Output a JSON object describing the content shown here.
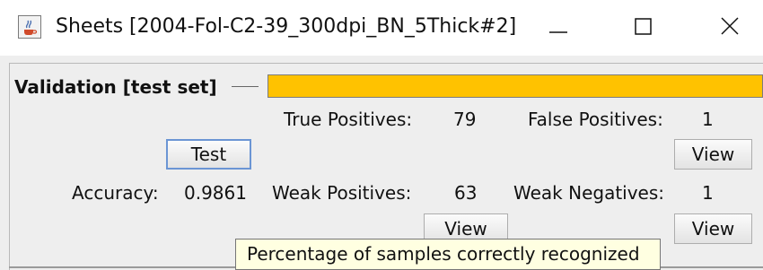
{
  "window": {
    "title": "Sheets [2004-Fol-C2-39_300dpi_BN_5Thick#2]",
    "icon": "java-coffee-cup-icon",
    "controls": {
      "minimize": "minimize-icon",
      "maximize": "maximize-icon",
      "close": "close-icon"
    }
  },
  "validation": {
    "section_label": "Validation [test set]",
    "progress": 1.0,
    "progress_color": "#ffc200",
    "true_positives_label": "True Positives:",
    "true_positives_value": "79",
    "false_positives_label": "False Positives:",
    "false_positives_value": "1",
    "test_button": "Test",
    "view_false_positives_button": "View",
    "accuracy_label": "Accuracy:",
    "accuracy_value": "0.9861",
    "weak_positives_label": "Weak Positives:",
    "weak_positives_value": "63",
    "weak_negatives_label": "Weak Negatives:",
    "weak_negatives_value": "1",
    "view_weak_positives_button": "View",
    "view_weak_negatives_button": "View"
  },
  "tooltip": {
    "text": "Percentage of samples correctly recognized",
    "background": "#ffffe1"
  }
}
